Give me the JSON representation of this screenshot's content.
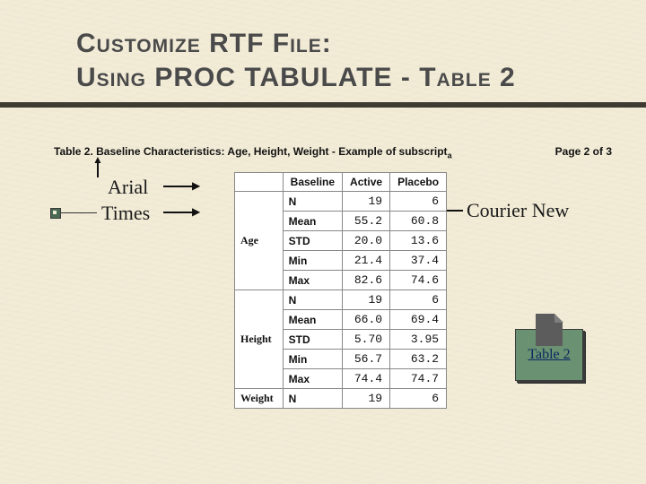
{
  "title_line1": "Customize RTF File:",
  "title_line2": "Using PROC TABULATE - Table 2",
  "caption": "Table 2. Baseline Characteristics: Age, Height, Weight - Example of subscript",
  "caption_sub": "a",
  "page_marker": "Page 2 of 3",
  "annotations": {
    "arial": "Arial",
    "times": "Times",
    "courier": "Courier New"
  },
  "link_label": "Table 2",
  "table": {
    "col_headers": [
      "Baseline",
      "Active",
      "Placebo"
    ],
    "stats": [
      "N",
      "Mean",
      "STD",
      "Min",
      "Max"
    ],
    "groups": [
      {
        "name": "Age",
        "rows": [
          {
            "stat": "N",
            "active": "19",
            "placebo": "6"
          },
          {
            "stat": "Mean",
            "active": "55.2",
            "placebo": "60.8"
          },
          {
            "stat": "STD",
            "active": "20.0",
            "placebo": "13.6"
          },
          {
            "stat": "Min",
            "active": "21.4",
            "placebo": "37.4"
          },
          {
            "stat": "Max",
            "active": "82.6",
            "placebo": "74.6"
          }
        ]
      },
      {
        "name": "Height",
        "rows": [
          {
            "stat": "N",
            "active": "19",
            "placebo": "6"
          },
          {
            "stat": "Mean",
            "active": "66.0",
            "placebo": "69.4"
          },
          {
            "stat": "STD",
            "active": "5.70",
            "placebo": "3.95"
          },
          {
            "stat": "Min",
            "active": "56.7",
            "placebo": "63.2"
          },
          {
            "stat": "Max",
            "active": "74.4",
            "placebo": "74.7"
          }
        ]
      },
      {
        "name": "Weight",
        "rows": [
          {
            "stat": "N",
            "active": "19",
            "placebo": "6"
          }
        ]
      }
    ]
  }
}
